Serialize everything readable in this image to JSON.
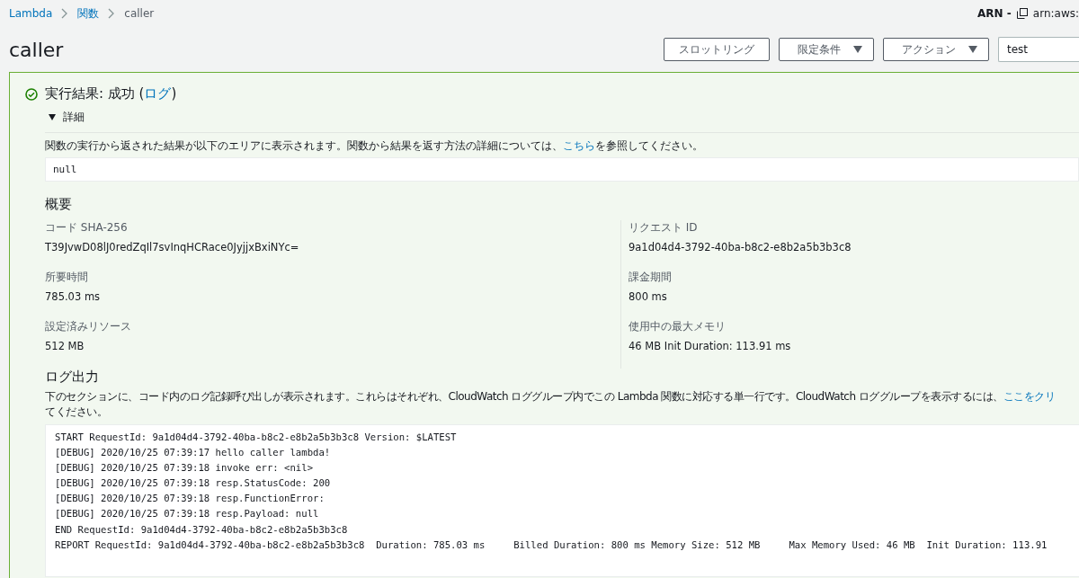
{
  "breadcrumbs": [
    {
      "label": "Lambda",
      "link": true
    },
    {
      "label": "関数",
      "link": true
    },
    {
      "label": "caller",
      "link": false
    }
  ],
  "arn": {
    "label": "ARN -",
    "value": "arn:aws:"
  },
  "title": "caller",
  "actions": [
    {
      "label": "スロットリング",
      "dropdown": false
    },
    {
      "label": "限定条件",
      "dropdown": true
    },
    {
      "label": "アクション",
      "dropdown": true
    }
  ],
  "test_event": {
    "value": "test"
  },
  "result": {
    "succeeded": true,
    "heading": "実行結果: 成功 (",
    "log_link": "ログ",
    "heading_end": ")",
    "details": {
      "label": "詳細",
      "expanded": true,
      "description": "関数の実行から返された結果が以下のエリアに表示されます。関数から結果を返す方法の詳細については、",
      "link": "こちら",
      "description_end": "を参照してください。",
      "output": "null"
    },
    "summary": {
      "heading": "概要",
      "fields": [
        {
          "label": "コード SHA-256",
          "value": "T39JvwD08lJ0redZqIl7svInqHCRace0JyjjxBxiNYc="
        },
        {
          "label": "リクエスト ID",
          "value": "9a1d04d4-3792-40ba-b8c2-e8b2a5b3b3c8"
        },
        {
          "label": "所要時間",
          "value": "785.03 ms"
        },
        {
          "label": "課金期間",
          "value": "800 ms"
        },
        {
          "label": "設定済みリソース",
          "value": "512 MB"
        },
        {
          "label": "使用中の最大メモリ",
          "value": "46 MB Init Duration: 113.91 ms"
        }
      ]
    },
    "log_output": {
      "heading": "ログ出力",
      "description": "下のセクションに、コード内のログ記録呼び出しが表示されます。これらはそれぞれ、CloudWatch ロググループ内でこの Lambda 関数に対応する単一行です。CloudWatch ロググループを表示するには、",
      "link": "ここをクリ",
      "description_end": "てください。",
      "lines": [
        "START RequestId: 9a1d04d4-3792-40ba-b8c2-e8b2a5b3b3c8 Version: $LATEST",
        "[DEBUG] 2020/10/25 07:39:17 hello caller lambda!",
        "[DEBUG] 2020/10/25 07:39:18 invoke err: <nil>",
        "[DEBUG] 2020/10/25 07:39:18 resp.StatusCode: 200",
        "[DEBUG] 2020/10/25 07:39:18 resp.FunctionError:",
        "[DEBUG] 2020/10/25 07:39:18 resp.Payload: null",
        "END RequestId: 9a1d04d4-3792-40ba-b8c2-e8b2a5b3b3c8",
        "REPORT RequestId: 9a1d04d4-3792-40ba-b8c2-e8b2a5b3b3c8  Duration: 785.03 ms     Billed Duration: 800 ms Memory Size: 512 MB     Max Memory Used: 46 MB  Init Duration: 113.91"
      ]
    }
  }
}
